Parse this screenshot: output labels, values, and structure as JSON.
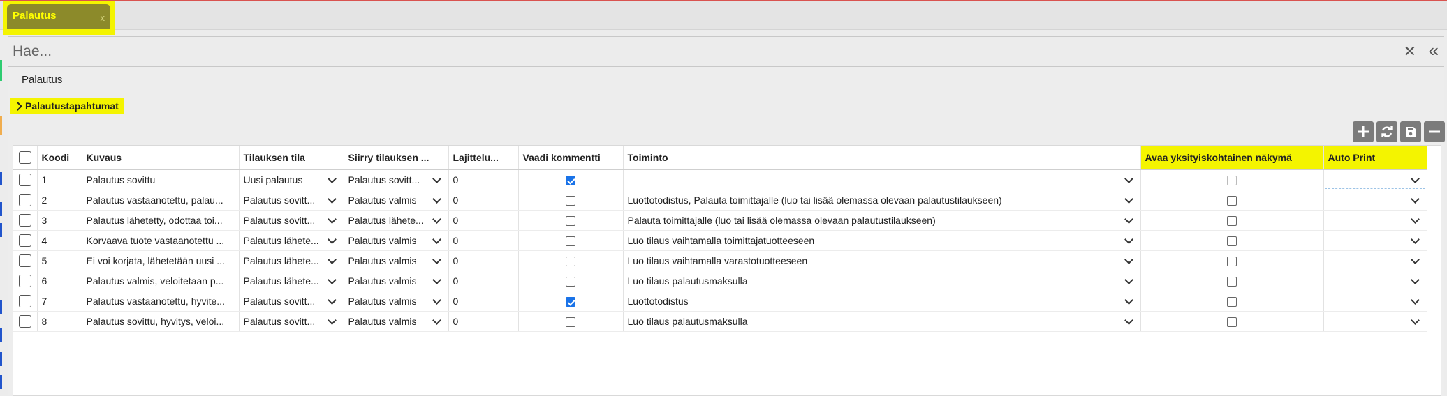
{
  "tab": {
    "label": "Palautus",
    "close": "x"
  },
  "search": {
    "placeholder": "Hae...",
    "value": ""
  },
  "section": {
    "title": "Palautus",
    "subsection": "Palautustapahtumat"
  },
  "toolbar": {
    "add": "add-icon",
    "refresh": "refresh-icon",
    "save": "save-icon",
    "minimize": "minus-icon"
  },
  "grid": {
    "columns": [
      "",
      "Koodi",
      "Kuvaus",
      "Tilauksen tila",
      "Siirry tilauksen ...",
      "Lajittelu...",
      "Vaadi kommentti",
      "Toiminto",
      "Avaa yksityiskohtainen näkymä",
      "Auto Print"
    ],
    "rows": [
      {
        "koodi": "1",
        "kuvaus": "Palautus sovittu",
        "tila": "Uusi palautus",
        "siirry": "Palautus sovitt...",
        "lajittelu": "0",
        "vaadi": true,
        "toiminto": "",
        "avaa": false,
        "avaa_disabled": true,
        "auto_print": ""
      },
      {
        "koodi": "2",
        "kuvaus": "Palautus vastaanotettu, palau...",
        "tila": "Palautus sovitt...",
        "siirry": "Palautus valmis",
        "lajittelu": "0",
        "vaadi": false,
        "toiminto": "Luottotodistus, Palauta toimittajalle (luo tai lisää olemassa olevaan palautustilaukseen)",
        "avaa": false,
        "avaa_disabled": false,
        "auto_print": ""
      },
      {
        "koodi": "3",
        "kuvaus": "Palautus lähetetty, odottaa toi...",
        "tila": "Palautus sovitt...",
        "siirry": "Palautus lähete...",
        "lajittelu": "0",
        "vaadi": false,
        "toiminto": "Palauta toimittajalle (luo tai lisää olemassa olevaan palautustilaukseen)",
        "avaa": false,
        "avaa_disabled": false,
        "auto_print": ""
      },
      {
        "koodi": "4",
        "kuvaus": "Korvaava tuote vastaanotettu ...",
        "tila": "Palautus lähete...",
        "siirry": "Palautus valmis",
        "lajittelu": "0",
        "vaadi": false,
        "toiminto": "Luo tilaus vaihtamalla toimittajatuotteeseen",
        "avaa": false,
        "avaa_disabled": false,
        "auto_print": ""
      },
      {
        "koodi": "5",
        "kuvaus": "Ei voi korjata, lähetetään uusi ...",
        "tila": "Palautus lähete...",
        "siirry": "Palautus valmis",
        "lajittelu": "0",
        "vaadi": false,
        "toiminto": "Luo tilaus vaihtamalla varastotuotteeseen",
        "avaa": false,
        "avaa_disabled": false,
        "auto_print": ""
      },
      {
        "koodi": "6",
        "kuvaus": "Palautus valmis, veloitetaan p...",
        "tila": "Palautus lähete...",
        "siirry": "Palautus valmis",
        "lajittelu": "0",
        "vaadi": false,
        "toiminto": "Luo tilaus palautusmaksulla",
        "avaa": false,
        "avaa_disabled": false,
        "auto_print": ""
      },
      {
        "koodi": "7",
        "kuvaus": "Palautus vastaanotettu, hyvite...",
        "tila": "Palautus sovitt...",
        "siirry": "Palautus valmis",
        "lajittelu": "0",
        "vaadi": true,
        "toiminto": "Luottotodistus",
        "avaa": false,
        "avaa_disabled": false,
        "auto_print": ""
      },
      {
        "koodi": "8",
        "kuvaus": "Palautus sovittu, hyvitys, veloi...",
        "tila": "Palautus sovitt...",
        "siirry": "Palautus valmis",
        "lajittelu": "0",
        "vaadi": false,
        "toiminto": "Luo tilaus palautusmaksulla",
        "avaa": false,
        "avaa_disabled": false,
        "auto_print": ""
      }
    ]
  },
  "colors": {
    "highlight": "#f4f400",
    "tab_bg": "#8c8a2a",
    "accent_red": "#d9534f",
    "checkbox_blue": "#1a73e8"
  }
}
